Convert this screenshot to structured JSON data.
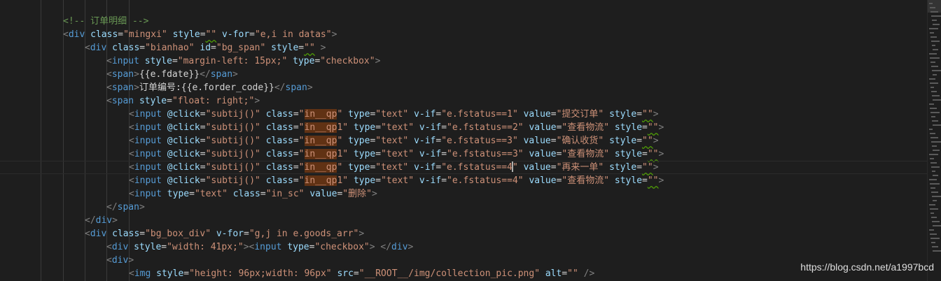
{
  "editor": {
    "cursor_line": 12,
    "lines": [
      [
        {
          "t": "<!-- 订单明细 -->",
          "c": "cm"
        }
      ],
      [
        {
          "t": "<",
          "c": "pn"
        },
        {
          "t": "div",
          "c": "tg"
        },
        {
          "t": " "
        },
        {
          "t": "class",
          "c": "an"
        },
        {
          "t": "=",
          "c": "tx"
        },
        {
          "t": "\"mingxi\"",
          "c": "sv"
        },
        {
          "t": " "
        },
        {
          "t": "style",
          "c": "an"
        },
        {
          "t": "=",
          "c": "tx"
        },
        {
          "t": "\"\"",
          "c": "sv",
          "w": true
        },
        {
          "t": " "
        },
        {
          "t": "v-for",
          "c": "an"
        },
        {
          "t": "=",
          "c": "tx"
        },
        {
          "t": "\"e,i in datas\"",
          "c": "sv"
        },
        {
          "t": ">",
          "c": "pn"
        }
      ],
      [
        {
          "t": "<",
          "c": "pn"
        },
        {
          "t": "div",
          "c": "tg"
        },
        {
          "t": " "
        },
        {
          "t": "class",
          "c": "an"
        },
        {
          "t": "=",
          "c": "tx"
        },
        {
          "t": "\"bianhao\"",
          "c": "sv"
        },
        {
          "t": " "
        },
        {
          "t": "id",
          "c": "an"
        },
        {
          "t": "=",
          "c": "tx"
        },
        {
          "t": "\"bg_span\"",
          "c": "sv"
        },
        {
          "t": " "
        },
        {
          "t": "style",
          "c": "an"
        },
        {
          "t": "=",
          "c": "tx"
        },
        {
          "t": "\"\"",
          "c": "sv",
          "w": true
        },
        {
          "t": " >",
          "c": "pn"
        }
      ],
      [
        {
          "t": "<",
          "c": "pn"
        },
        {
          "t": "input",
          "c": "tg"
        },
        {
          "t": " "
        },
        {
          "t": "style",
          "c": "an"
        },
        {
          "t": "=",
          "c": "tx"
        },
        {
          "t": "\"margin-left: 15px;\"",
          "c": "sv"
        },
        {
          "t": " "
        },
        {
          "t": "type",
          "c": "an"
        },
        {
          "t": "=",
          "c": "tx"
        },
        {
          "t": "\"checkbox\"",
          "c": "sv"
        },
        {
          "t": ">",
          "c": "pn"
        }
      ],
      [
        {
          "t": "<",
          "c": "pn"
        },
        {
          "t": "span",
          "c": "tg"
        },
        {
          "t": ">",
          "c": "pn"
        },
        {
          "t": "{{e.fdate}}",
          "c": "tx"
        },
        {
          "t": "</",
          "c": "pn"
        },
        {
          "t": "span",
          "c": "tg"
        },
        {
          "t": ">",
          "c": "pn"
        }
      ],
      [
        {
          "t": "<",
          "c": "pn"
        },
        {
          "t": "span",
          "c": "tg"
        },
        {
          "t": ">",
          "c": "pn"
        },
        {
          "t": "订单编号:{{e.forder_code}}",
          "c": "tx"
        },
        {
          "t": "</",
          "c": "pn"
        },
        {
          "t": "span",
          "c": "tg"
        },
        {
          "t": ">",
          "c": "pn"
        }
      ],
      [
        {
          "t": "<",
          "c": "pn"
        },
        {
          "t": "span",
          "c": "tg"
        },
        {
          "t": " "
        },
        {
          "t": "style",
          "c": "an"
        },
        {
          "t": "=",
          "c": "tx"
        },
        {
          "t": "\"float: right;\"",
          "c": "sv"
        },
        {
          "t": ">",
          "c": "pn"
        }
      ],
      [
        {
          "t": "<",
          "c": "pn"
        },
        {
          "t": "input",
          "c": "tg"
        },
        {
          "t": " "
        },
        {
          "t": "@click",
          "c": "an"
        },
        {
          "t": "=",
          "c": "tx"
        },
        {
          "t": "\"subtij()\"",
          "c": "sv"
        },
        {
          "t": " "
        },
        {
          "t": "class",
          "c": "an"
        },
        {
          "t": "=",
          "c": "tx"
        },
        {
          "t": "\"",
          "c": "sv"
        },
        {
          "t": "in__qp",
          "c": "sv",
          "h": true
        },
        {
          "t": "\"",
          "c": "sv"
        },
        {
          "t": " "
        },
        {
          "t": "type",
          "c": "an"
        },
        {
          "t": "=",
          "c": "tx"
        },
        {
          "t": "\"text\"",
          "c": "sv"
        },
        {
          "t": " "
        },
        {
          "t": "v-if",
          "c": "an"
        },
        {
          "t": "=",
          "c": "tx"
        },
        {
          "t": "\"e.fstatus==1\"",
          "c": "sv"
        },
        {
          "t": " "
        },
        {
          "t": "value",
          "c": "an"
        },
        {
          "t": "=",
          "c": "tx"
        },
        {
          "t": "\"提交订单\"",
          "c": "sv"
        },
        {
          "t": " "
        },
        {
          "t": "style",
          "c": "an"
        },
        {
          "t": "=",
          "c": "tx"
        },
        {
          "t": "\"\"",
          "c": "sv",
          "w": true
        },
        {
          "t": ">",
          "c": "pn"
        }
      ],
      [
        {
          "t": "<",
          "c": "pn"
        },
        {
          "t": "input",
          "c": "tg"
        },
        {
          "t": " "
        },
        {
          "t": "@click",
          "c": "an"
        },
        {
          "t": "=",
          "c": "tx"
        },
        {
          "t": "\"subtij()\"",
          "c": "sv"
        },
        {
          "t": " "
        },
        {
          "t": "class",
          "c": "an"
        },
        {
          "t": "=",
          "c": "tx"
        },
        {
          "t": "\"",
          "c": "sv"
        },
        {
          "t": "in__qp",
          "c": "sv",
          "h": true
        },
        {
          "t": "1\"",
          "c": "sv"
        },
        {
          "t": " "
        },
        {
          "t": "type",
          "c": "an"
        },
        {
          "t": "=",
          "c": "tx"
        },
        {
          "t": "\"text\"",
          "c": "sv"
        },
        {
          "t": " "
        },
        {
          "t": "v-if",
          "c": "an"
        },
        {
          "t": "=",
          "c": "tx"
        },
        {
          "t": "\"e.fstatus==2\"",
          "c": "sv"
        },
        {
          "t": " "
        },
        {
          "t": "value",
          "c": "an"
        },
        {
          "t": "=",
          "c": "tx"
        },
        {
          "t": "\"查看物流\"",
          "c": "sv"
        },
        {
          "t": " "
        },
        {
          "t": "style",
          "c": "an"
        },
        {
          "t": "=",
          "c": "tx"
        },
        {
          "t": "\"\"",
          "c": "sv",
          "w": true
        },
        {
          "t": ">",
          "c": "pn"
        }
      ],
      [
        {
          "t": "<",
          "c": "pn"
        },
        {
          "t": "input",
          "c": "tg"
        },
        {
          "t": " "
        },
        {
          "t": "@click",
          "c": "an"
        },
        {
          "t": "=",
          "c": "tx"
        },
        {
          "t": "\"subtij()\"",
          "c": "sv"
        },
        {
          "t": " "
        },
        {
          "t": "class",
          "c": "an"
        },
        {
          "t": "=",
          "c": "tx"
        },
        {
          "t": "\"",
          "c": "sv"
        },
        {
          "t": "in__qp",
          "c": "sv",
          "h": true
        },
        {
          "t": "\"",
          "c": "sv"
        },
        {
          "t": " "
        },
        {
          "t": "type",
          "c": "an"
        },
        {
          "t": "=",
          "c": "tx"
        },
        {
          "t": "\"text\"",
          "c": "sv"
        },
        {
          "t": " "
        },
        {
          "t": "v-if",
          "c": "an"
        },
        {
          "t": "=",
          "c": "tx"
        },
        {
          "t": "\"e.fstatus==3\"",
          "c": "sv"
        },
        {
          "t": " "
        },
        {
          "t": "value",
          "c": "an"
        },
        {
          "t": "=",
          "c": "tx"
        },
        {
          "t": "\"确认收货\"",
          "c": "sv"
        },
        {
          "t": " "
        },
        {
          "t": "style",
          "c": "an"
        },
        {
          "t": "=",
          "c": "tx"
        },
        {
          "t": "\"\"",
          "c": "sv",
          "w": true
        },
        {
          "t": ">",
          "c": "pn"
        }
      ],
      [
        {
          "t": "<",
          "c": "pn"
        },
        {
          "t": "input",
          "c": "tg"
        },
        {
          "t": " "
        },
        {
          "t": "@click",
          "c": "an"
        },
        {
          "t": "=",
          "c": "tx"
        },
        {
          "t": "\"subtij()\"",
          "c": "sv"
        },
        {
          "t": " "
        },
        {
          "t": "class",
          "c": "an"
        },
        {
          "t": "=",
          "c": "tx"
        },
        {
          "t": "\"",
          "c": "sv"
        },
        {
          "t": "in__qp",
          "c": "sv",
          "h": true
        },
        {
          "t": "1\"",
          "c": "sv"
        },
        {
          "t": " "
        },
        {
          "t": "type",
          "c": "an"
        },
        {
          "t": "=",
          "c": "tx"
        },
        {
          "t": "\"text\"",
          "c": "sv"
        },
        {
          "t": " "
        },
        {
          "t": "v-if",
          "c": "an"
        },
        {
          "t": "=",
          "c": "tx"
        },
        {
          "t": "\"e.fstatus==3\"",
          "c": "sv"
        },
        {
          "t": " "
        },
        {
          "t": "value",
          "c": "an"
        },
        {
          "t": "=",
          "c": "tx"
        },
        {
          "t": "\"查看物流\"",
          "c": "sv"
        },
        {
          "t": " "
        },
        {
          "t": "style",
          "c": "an"
        },
        {
          "t": "=",
          "c": "tx"
        },
        {
          "t": "\"\"",
          "c": "sv",
          "w": true
        },
        {
          "t": ">",
          "c": "pn"
        }
      ],
      [
        {
          "t": "<",
          "c": "pn"
        },
        {
          "t": "input",
          "c": "tg"
        },
        {
          "t": " "
        },
        {
          "t": "@click",
          "c": "an"
        },
        {
          "t": "=",
          "c": "tx"
        },
        {
          "t": "\"subtij()\"",
          "c": "sv"
        },
        {
          "t": " "
        },
        {
          "t": "class",
          "c": "an"
        },
        {
          "t": "=",
          "c": "tx"
        },
        {
          "t": "\"",
          "c": "sv"
        },
        {
          "t": "in__qp",
          "c": "sv",
          "h": true
        },
        {
          "t": "\"",
          "c": "sv"
        },
        {
          "t": " "
        },
        {
          "t": "type",
          "c": "an"
        },
        {
          "t": "=",
          "c": "tx"
        },
        {
          "t": "\"text\"",
          "c": "sv"
        },
        {
          "t": " "
        },
        {
          "t": "v-if",
          "c": "an"
        },
        {
          "t": "=",
          "c": "tx"
        },
        {
          "t": "\"e.fstatus==4",
          "c": "sv",
          "cur": true
        },
        {
          "t": "\"",
          "c": "sv"
        },
        {
          "t": " "
        },
        {
          "t": "value",
          "c": "an"
        },
        {
          "t": "=",
          "c": "tx"
        },
        {
          "t": "\"再来一单\"",
          "c": "sv"
        },
        {
          "t": " "
        },
        {
          "t": "style",
          "c": "an"
        },
        {
          "t": "=",
          "c": "tx"
        },
        {
          "t": "\"\"",
          "c": "sv",
          "w": true
        },
        {
          "t": ">",
          "c": "pn"
        }
      ],
      [
        {
          "t": "<",
          "c": "pn"
        },
        {
          "t": "input",
          "c": "tg"
        },
        {
          "t": " "
        },
        {
          "t": "@click",
          "c": "an"
        },
        {
          "t": "=",
          "c": "tx"
        },
        {
          "t": "\"subtij()\"",
          "c": "sv"
        },
        {
          "t": " "
        },
        {
          "t": "class",
          "c": "an"
        },
        {
          "t": "=",
          "c": "tx"
        },
        {
          "t": "\"",
          "c": "sv"
        },
        {
          "t": "in__qp",
          "c": "sv",
          "h": true
        },
        {
          "t": "1\"",
          "c": "sv"
        },
        {
          "t": " "
        },
        {
          "t": "type",
          "c": "an"
        },
        {
          "t": "=",
          "c": "tx"
        },
        {
          "t": "\"text\"",
          "c": "sv"
        },
        {
          "t": " "
        },
        {
          "t": "v-if",
          "c": "an"
        },
        {
          "t": "=",
          "c": "tx"
        },
        {
          "t": "\"e.fstatus==4\"",
          "c": "sv"
        },
        {
          "t": " "
        },
        {
          "t": "value",
          "c": "an"
        },
        {
          "t": "=",
          "c": "tx"
        },
        {
          "t": "\"查看物流\"",
          "c": "sv"
        },
        {
          "t": " "
        },
        {
          "t": "style",
          "c": "an"
        },
        {
          "t": "=",
          "c": "tx"
        },
        {
          "t": "\"\"",
          "c": "sv",
          "w": true
        },
        {
          "t": ">",
          "c": "pn"
        }
      ],
      [
        {
          "t": "<",
          "c": "pn"
        },
        {
          "t": "input",
          "c": "tg"
        },
        {
          "t": " "
        },
        {
          "t": "type",
          "c": "an"
        },
        {
          "t": "=",
          "c": "tx"
        },
        {
          "t": "\"text\"",
          "c": "sv"
        },
        {
          "t": " "
        },
        {
          "t": "class",
          "c": "an"
        },
        {
          "t": "=",
          "c": "tx"
        },
        {
          "t": "\"in_sc\"",
          "c": "sv"
        },
        {
          "t": " "
        },
        {
          "t": "value",
          "c": "an"
        },
        {
          "t": "=",
          "c": "tx"
        },
        {
          "t": "\"删除\"",
          "c": "sv"
        },
        {
          "t": ">",
          "c": "pn"
        }
      ],
      [
        {
          "t": "</",
          "c": "pn"
        },
        {
          "t": "span",
          "c": "tg"
        },
        {
          "t": ">",
          "c": "pn"
        }
      ],
      [
        {
          "t": "</",
          "c": "pn"
        },
        {
          "t": "div",
          "c": "tg"
        },
        {
          "t": ">",
          "c": "pn"
        }
      ],
      [
        {
          "t": "<",
          "c": "pn"
        },
        {
          "t": "div",
          "c": "tg"
        },
        {
          "t": " "
        },
        {
          "t": "class",
          "c": "an"
        },
        {
          "t": "=",
          "c": "tx"
        },
        {
          "t": "\"bg_box_div\"",
          "c": "sv"
        },
        {
          "t": " "
        },
        {
          "t": "v-for",
          "c": "an"
        },
        {
          "t": "=",
          "c": "tx"
        },
        {
          "t": "\"g,j in e.goods_arr\"",
          "c": "sv"
        },
        {
          "t": ">",
          "c": "pn"
        }
      ],
      [
        {
          "t": "<",
          "c": "pn"
        },
        {
          "t": "div",
          "c": "tg"
        },
        {
          "t": " "
        },
        {
          "t": "style",
          "c": "an"
        },
        {
          "t": "=",
          "c": "tx"
        },
        {
          "t": "\"width: 41px;\"",
          "c": "sv"
        },
        {
          "t": ">",
          "c": "pn"
        },
        {
          "t": "<",
          "c": "pn"
        },
        {
          "t": "input",
          "c": "tg"
        },
        {
          "t": " "
        },
        {
          "t": "type",
          "c": "an"
        },
        {
          "t": "=",
          "c": "tx"
        },
        {
          "t": "\"checkbox\"",
          "c": "sv"
        },
        {
          "t": ">",
          "c": "pn"
        },
        {
          "t": " "
        },
        {
          "t": "</",
          "c": "pn"
        },
        {
          "t": "div",
          "c": "tg"
        },
        {
          "t": ">",
          "c": "pn"
        }
      ],
      [
        {
          "t": "<",
          "c": "pn"
        },
        {
          "t": "div",
          "c": "tg"
        },
        {
          "t": ">",
          "c": "pn"
        }
      ],
      [
        {
          "t": "<",
          "c": "pn"
        },
        {
          "t": "img",
          "c": "tg"
        },
        {
          "t": " "
        },
        {
          "t": "style",
          "c": "an"
        },
        {
          "t": "=",
          "c": "tx"
        },
        {
          "t": "\"height: 96px;width: 96px\"",
          "c": "sv"
        },
        {
          "t": " "
        },
        {
          "t": "src",
          "c": "an"
        },
        {
          "t": "=",
          "c": "tx"
        },
        {
          "t": "\"__ROOT__/img/collection_pic.png\"",
          "c": "sv"
        },
        {
          "t": " "
        },
        {
          "t": "alt",
          "c": "an"
        },
        {
          "t": "=",
          "c": "tx"
        },
        {
          "t": "\"\"",
          "c": "sv"
        },
        {
          "t": " />",
          "c": "pn"
        }
      ]
    ]
  },
  "watermark": "https://blog.csdn.net/a1997bcd"
}
